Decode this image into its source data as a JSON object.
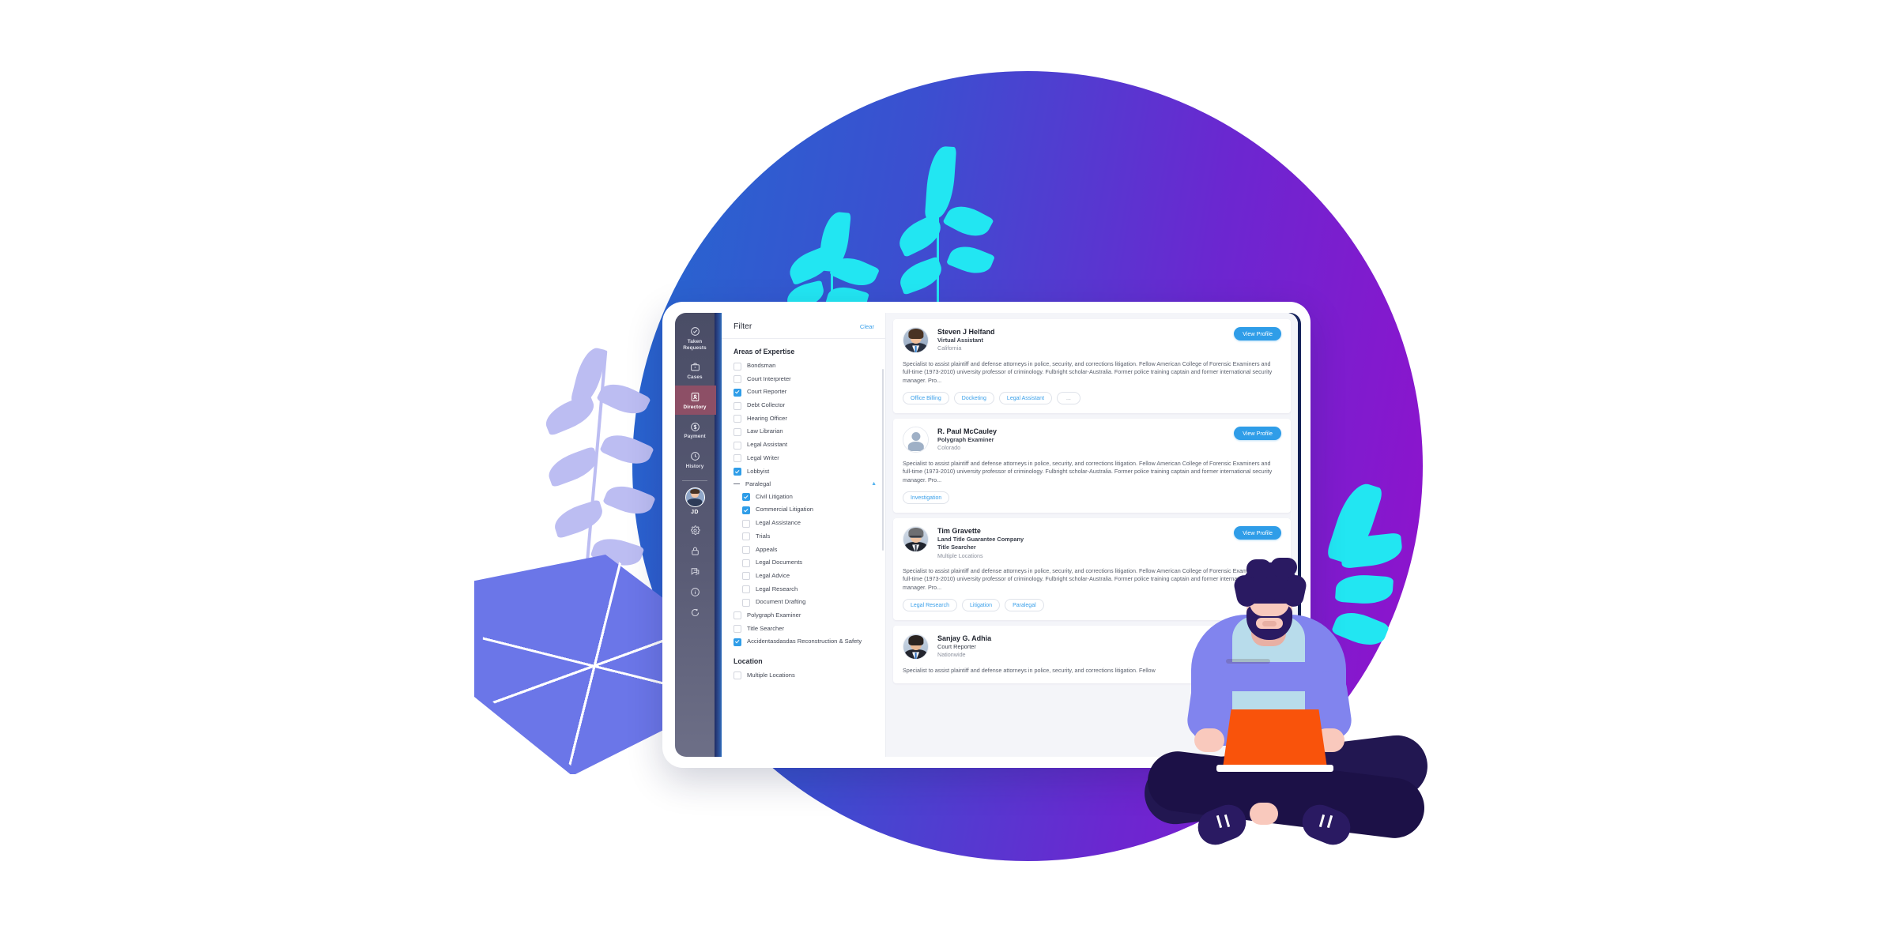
{
  "app": {
    "theme": {
      "accent_blue": "#2f9de8",
      "active_nav": "#8d4f66",
      "bg_gradient_start": "#2469cf",
      "bg_gradient_end": "#9310cc",
      "cyan_leaf": "#22e6f2",
      "lavender_leaf": "#bcbdf2",
      "blue_leaf": "#6b76e8",
      "laptop_orange": "#f9530b"
    }
  },
  "rail": {
    "items": [
      {
        "label": "Taken\nRequests",
        "label_line1": "Taken",
        "label_line2": "Requests",
        "icon": "check-circle-icon",
        "active": false
      },
      {
        "label": "Cases",
        "icon": "briefcase-icon",
        "active": false
      },
      {
        "label": "Directory",
        "icon": "address-book-icon",
        "active": true
      },
      {
        "label": "Payment",
        "icon": "dollar-circle-icon",
        "active": false
      },
      {
        "label": "History",
        "icon": "clock-icon",
        "active": false
      }
    ],
    "user": {
      "initials": "JD",
      "avatar": "user-avatar"
    },
    "mini_icons": [
      "gear-icon",
      "lock-icon",
      "chat-icon",
      "info-icon",
      "logout-icon"
    ]
  },
  "filter": {
    "title": "Filter",
    "clear_label": "Clear",
    "sections": [
      {
        "title": "Areas of Expertise",
        "options": [
          {
            "label": "Bondsman",
            "checked": false
          },
          {
            "label": "Court Interpreter",
            "checked": false
          },
          {
            "label": "Court Reporter",
            "checked": true
          },
          {
            "label": "Debt Collector",
            "checked": false
          },
          {
            "label": "Hearing Officer",
            "checked": false
          },
          {
            "label": "Law Librarian",
            "checked": false
          },
          {
            "label": "Legal Assistant",
            "checked": false
          },
          {
            "label": "Legal Writer",
            "checked": false
          },
          {
            "label": "Lobbyist",
            "checked": true
          },
          {
            "label": "Paralegal",
            "type": "group",
            "state": "indeterminate",
            "expanded": true,
            "children": [
              {
                "label": "Civil Litigation",
                "checked": true
              },
              {
                "label": "Commercial Litigation",
                "checked": true
              },
              {
                "label": "Legal Assistance",
                "checked": false
              },
              {
                "label": "Trials",
                "checked": false
              },
              {
                "label": "Appeals",
                "checked": false
              },
              {
                "label": "Legal Documents",
                "checked": false
              },
              {
                "label": "Legal Advice",
                "checked": false
              },
              {
                "label": "Legal Research",
                "checked": false
              },
              {
                "label": "Document Drafting",
                "checked": false
              }
            ]
          },
          {
            "label": "Polygraph Examiner",
            "checked": false
          },
          {
            "label": "Title Searcher",
            "checked": false
          },
          {
            "label": "Accidentasdasdas Reconstruction & Safety",
            "checked": true
          }
        ]
      },
      {
        "title": "Location",
        "options": [
          {
            "label": "Multiple Locations",
            "checked": false
          }
        ]
      }
    ]
  },
  "results": {
    "view_profile_label": "View Profile",
    "cards": [
      {
        "name": "Steven J Helfand",
        "role": "Virtual Assistant",
        "location": "California",
        "avatar_kind": "photo-man-blue-tie",
        "description": "Specialist to assist plaintiff and defense attorneys in police, security, and corrections litigation. Fellow American College of Forensic Examiners and full-time (1973-2010) university professor of criminology. Fulbright scholar-Australia. Former police training captain and former international security manager. Pro...",
        "tags": [
          "Office Billing",
          "Docketing",
          "Legal Assistant",
          "..."
        ]
      },
      {
        "name": "R. Paul McCauley",
        "role": "Polygraph Examiner",
        "location": "Colorado",
        "avatar_kind": "placeholder",
        "description": "Specialist to assist plaintiff and defense attorneys in police, security, and corrections litigation. Fellow American College of Forensic Examiners and full-time (1973-2010) university professor of criminology. Fulbright scholar-Australia. Former police training captain and former international security manager. Pro...",
        "tags": [
          "Investigation"
        ]
      },
      {
        "name": "Tim Gravette",
        "company": "Land Title Guarantee Company",
        "role": "Title Searcher",
        "location": "Multiple Locations",
        "avatar_kind": "photo-man-glasses",
        "description": "Specialist to assist plaintiff and defense attorneys in police, security, and corrections litigation. Fellow American College of Forensic Examiners and full-time (1973-2010) university professor of criminology. Fulbright scholar-Australia. Former police training captain and former international security manager. Pro...",
        "tags": [
          "Legal Research",
          "Litigation",
          "Paralegal"
        ]
      },
      {
        "name": "Sanjay G. Adhia",
        "role": "Court Reporter",
        "location": "Nationwide",
        "avatar_kind": "photo-man-smiling",
        "description": "Specialist to assist plaintiff and defense attorneys in police, security, and corrections litigation. Fellow",
        "tags": []
      }
    ]
  }
}
